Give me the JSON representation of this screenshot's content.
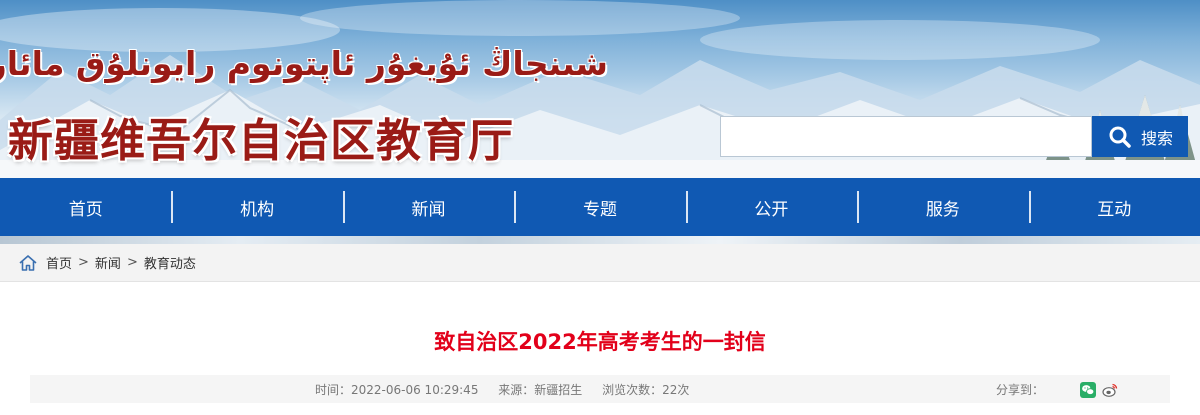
{
  "header": {
    "site_name_uyghur": "شىنجاڭ ئۇيغۇر ئاپتونوم رايونلۇق مائارىپ نازارىتى",
    "site_name_chinese": "新疆维吾尔自治区教育厅",
    "search": {
      "value": "",
      "placeholder": "",
      "button_label": "搜索"
    }
  },
  "nav": {
    "items": [
      {
        "label": "首页"
      },
      {
        "label": "机构"
      },
      {
        "label": "新闻"
      },
      {
        "label": "专题"
      },
      {
        "label": "公开"
      },
      {
        "label": "服务"
      },
      {
        "label": "互动"
      }
    ]
  },
  "breadcrumb": {
    "items": [
      "首页",
      "新闻",
      "教育动态"
    ],
    "separator": ">"
  },
  "article": {
    "title": "致自治区2022年高考考生的一封信",
    "time": "时间：2022-06-06 10:29:45",
    "source": "来源：新疆招生",
    "views": "浏览次数：22次",
    "share_label": "分享到："
  },
  "icons": {
    "search": "search-icon",
    "home": "home-icon",
    "wechat": "wechat-icon",
    "weibo": "weibo-icon"
  },
  "colors": {
    "brand_blue": "#1059b3",
    "title_red": "#e2001a",
    "site_name_red": "#9a1b16",
    "wechat_green": "#2aae67"
  }
}
